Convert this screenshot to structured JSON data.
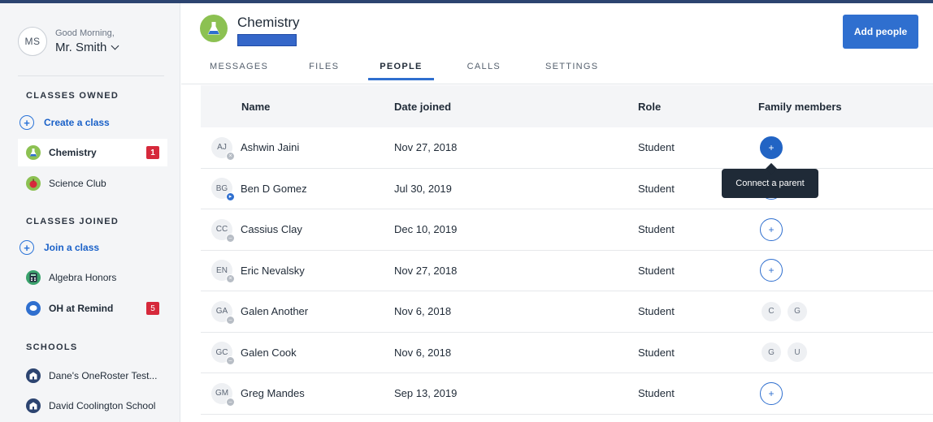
{
  "profile": {
    "initials": "MS",
    "greeting": "Good Morning,",
    "name": "Mr. Smith"
  },
  "sidebar": {
    "classes_owned_title": "CLASSES OWNED",
    "create_class": "Create a class",
    "owned": [
      {
        "label": "Chemistry",
        "badge": "1",
        "icon": "flask-icon"
      },
      {
        "label": "Science Club",
        "icon": "apple-icon"
      }
    ],
    "classes_joined_title": "CLASSES JOINED",
    "join_class": "Join a class",
    "joined": [
      {
        "label": "Algebra Honors",
        "icon": "calculator-icon"
      },
      {
        "label": "OH at Remind",
        "badge": "5",
        "icon": "chat-bubble-icon"
      }
    ],
    "schools_title": "SCHOOLS",
    "schools": [
      {
        "label": "Dane's OneRoster Test...",
        "icon": "school-icon"
      },
      {
        "label": "David Coolington School",
        "icon": "school-icon"
      }
    ]
  },
  "header": {
    "class_title": "Chemistry",
    "add_people": "Add people",
    "tabs": [
      "MESSAGES",
      "FILES",
      "PEOPLE",
      "CALLS",
      "SETTINGS"
    ],
    "active_tab": "PEOPLE"
  },
  "table": {
    "columns": {
      "name": "Name",
      "date": "Date joined",
      "role": "Role",
      "family": "Family members"
    },
    "rows": [
      {
        "initials": "AJ",
        "name": "Ashwin Jaini",
        "date": "Nov 27, 2018",
        "role": "Student"
      },
      {
        "initials": "BG",
        "name": "Ben D Gomez",
        "date": "Jul 30, 2019",
        "role": "Student"
      },
      {
        "initials": "CC",
        "name": "Cassius Clay",
        "date": "Dec 10, 2019",
        "role": "Student"
      },
      {
        "initials": "EN",
        "name": "Eric Nevalsky",
        "date": "Nov 27, 2018",
        "role": "Student"
      },
      {
        "initials": "GA",
        "name": "Galen Another",
        "date": "Nov 6, 2018",
        "role": "Student",
        "family": [
          "C",
          "G"
        ]
      },
      {
        "initials": "GC",
        "name": "Galen Cook",
        "date": "Nov 6, 2018",
        "role": "Student",
        "family": [
          "G",
          "U"
        ]
      },
      {
        "initials": "GM",
        "name": "Greg Mandes",
        "date": "Sep 13, 2019",
        "role": "Student"
      }
    ]
  },
  "tooltip": "Connect a parent",
  "colors": {
    "accent": "#2f6fcf",
    "badge": "#d6293b",
    "class_green": "#8cc152"
  }
}
